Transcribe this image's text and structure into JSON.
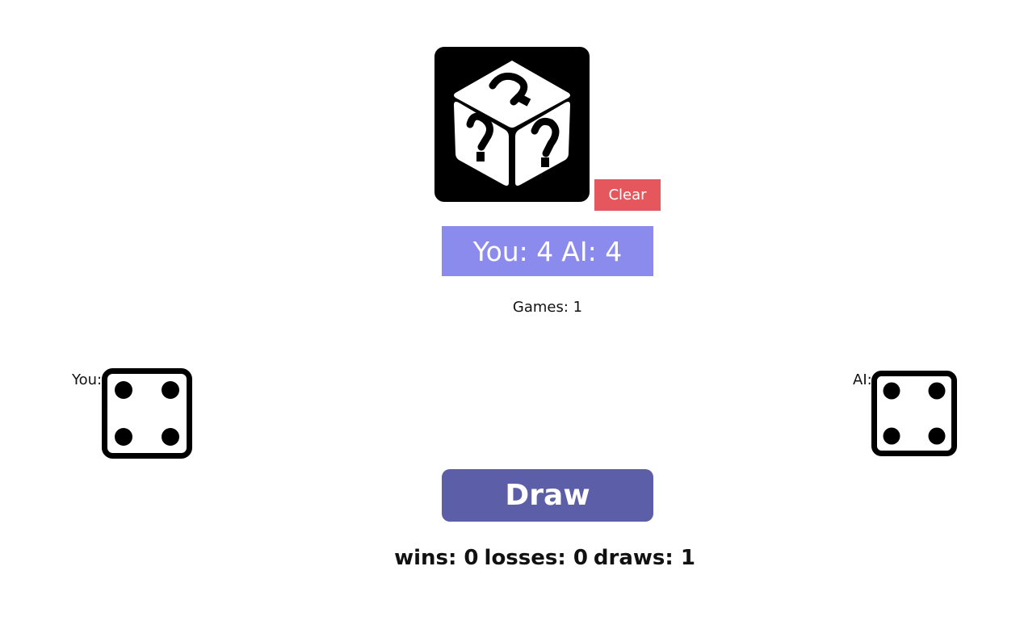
{
  "header": {
    "mystery_die_icon": "mystery-dice-icon",
    "clear_label": "Clear",
    "clear_color": "#e5565d"
  },
  "score": {
    "you": "You: 4",
    "ai": "AI: 4",
    "banner_color": "#8b8bee"
  },
  "games": {
    "text": "Games: 1"
  },
  "players": {
    "you": {
      "label": "You:",
      "die_value": 4
    },
    "ai": {
      "label": "AI:",
      "die_value": 4
    }
  },
  "actions": {
    "draw_label": "Draw",
    "draw_color": "#5c5fa8"
  },
  "record": {
    "wins": "wins: 0",
    "losses": "losses: 0",
    "draws": "draws: 1"
  }
}
